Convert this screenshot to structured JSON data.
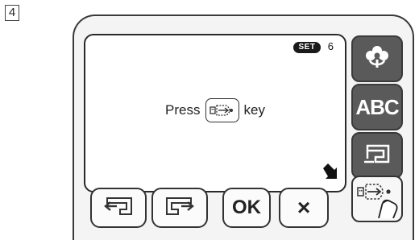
{
  "step": {
    "number": "4"
  },
  "screen": {
    "badge_label": "SET",
    "badge_value": "6",
    "message_before": "Press",
    "message_after": "key",
    "inline_icon": "usb-key-icon",
    "corner_icon": "arrow-down-right-icon"
  },
  "side_panel": {
    "buttons": [
      {
        "icon": "flower-icon"
      },
      {
        "label": "ABC"
      },
      {
        "icon": "sewing-machine-icon"
      },
      {
        "icon": "usb-key-icon"
      }
    ]
  },
  "bottom_bar": {
    "buttons": [
      {
        "icon": "move-left-icon"
      },
      {
        "icon": "move-right-icon"
      },
      {
        "label": "OK"
      },
      {
        "label": "×"
      }
    ]
  },
  "colors": {
    "outline": "#333333",
    "side_button_dark": "#5a5a5a",
    "screen_bg": "#ffffff"
  }
}
